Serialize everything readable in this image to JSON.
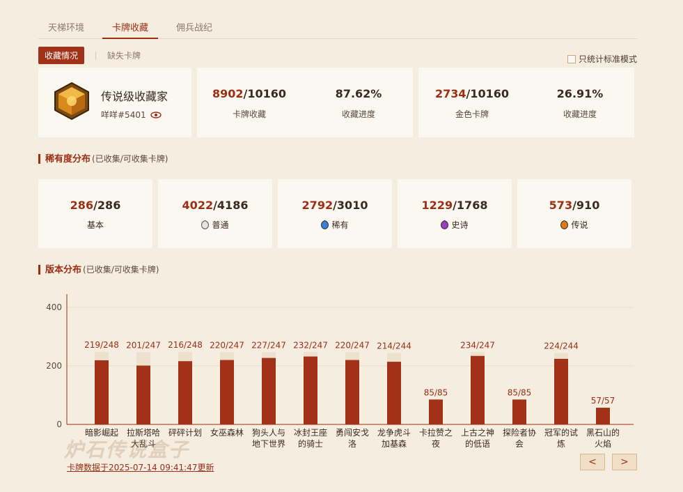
{
  "tabs": [
    "天梯环境",
    "卡牌收藏",
    "佣兵战纪"
  ],
  "subtabs": {
    "active": "收藏情况",
    "other": "缺失卡牌"
  },
  "std_toggle": "只统计标准模式",
  "profile": {
    "rank": "传说级收藏家",
    "user": "咩咩#5401"
  },
  "stats": {
    "cards_have": "8902",
    "cards_total": "/10160",
    "cards_label": "卡牌收藏",
    "cards_pct": "87.62%",
    "cards_pct_label": "收藏进度",
    "gold_have": "2734",
    "gold_total": "/10160",
    "gold_label": "金色卡牌",
    "gold_pct": "26.91%",
    "gold_pct_label": "收藏进度"
  },
  "rarity_title": "稀有度分布",
  "rarity_sub": "(已收集/可收集卡牌)",
  "rarity": [
    {
      "have": "286",
      "total": "/286",
      "label": "基本",
      "gem": null
    },
    {
      "have": "4022",
      "total": "/4186",
      "label": "普通",
      "gem": "#bdbdbd"
    },
    {
      "have": "2792",
      "total": "/3010",
      "label": "稀有",
      "gem": "#3a7fd8"
    },
    {
      "have": "1229",
      "total": "/1768",
      "label": "史诗",
      "gem": "#9b3bc6"
    },
    {
      "have": "573",
      "total": "/910",
      "label": "传说",
      "gem": "#e07a12"
    }
  ],
  "set_title": "版本分布",
  "set_sub": "(已收集/可收集卡牌)",
  "chart_data": {
    "type": "bar",
    "categories": [
      "暗影崛起",
      "拉斯塔哈大乱斗",
      "砰砰计划",
      "女巫森林",
      "狗头人与地下世界",
      "冰封王座的骑士",
      "勇闯安戈洛",
      "龙争虎斗加基森",
      "卡拉赞之夜",
      "上古之神的低语",
      "探险者协会",
      "冠军的试炼",
      "黑石山的火焰"
    ],
    "category_lines": [
      [
        "暗影崛起"
      ],
      [
        "拉斯塔哈",
        "大乱斗"
      ],
      [
        "砰砰计划"
      ],
      [
        "女巫森林"
      ],
      [
        "狗头人与",
        "地下世界"
      ],
      [
        "冰封王座",
        "的骑士"
      ],
      [
        "勇闯安戈",
        "洛"
      ],
      [
        "龙争虎斗",
        "加基森"
      ],
      [
        "卡拉赞之",
        "夜"
      ],
      [
        "上古之神",
        "的低语"
      ],
      [
        "探险者协",
        "会"
      ],
      [
        "冠军的试",
        "炼"
      ],
      [
        "黑石山的",
        "火焰"
      ]
    ],
    "series": [
      {
        "values": [
          219,
          201,
          216,
          220,
          227,
          232,
          220,
          214,
          85,
          234,
          85,
          224,
          57
        ]
      },
      {
        "values": [
          248,
          247,
          248,
          247,
          247,
          247,
          247,
          244,
          85,
          247,
          85,
          244,
          57
        ]
      }
    ],
    "data_labels": [
      "219/248",
      "201/247",
      "216/248",
      "220/247",
      "227/247",
      "232/247",
      "220/247",
      "214/244",
      "85/85",
      "234/247",
      "85/85",
      "224/244",
      "57/57"
    ],
    "yticks": [
      0,
      200,
      400
    ],
    "ylim": [
      0,
      400
    ],
    "colors": {
      "have": "#a13217",
      "total": "#ede0cc"
    }
  },
  "updated": "卡牌数据于2025-07-14 09:41:47更新",
  "watermark": "炉石传说盒子",
  "nav": {
    "prev": "<",
    "next": ">"
  }
}
